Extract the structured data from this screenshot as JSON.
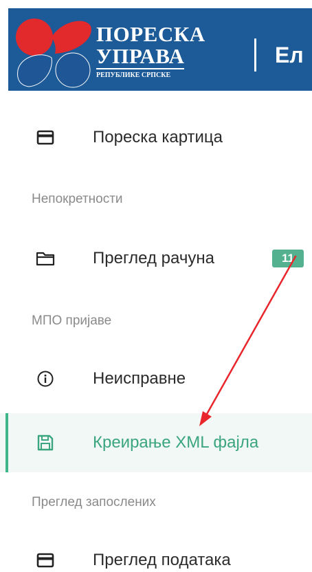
{
  "header": {
    "brand_line1": "ПОРЕСКА",
    "brand_line2": "УПРАВА",
    "brand_sub": "РЕПУБЛИКЕ СРПСКЕ",
    "title_fragment": "Ел",
    "bg_color": "#1c5a98",
    "logo_colors": {
      "top": "#e2292c",
      "bottom": "#1f5796"
    }
  },
  "menu": {
    "tax_card": {
      "label": "Пореска картица",
      "icon": "card-icon"
    },
    "real_estate_section": "Непокретности",
    "account_overview": {
      "label": "Преглед рачуна",
      "icon": "folder-icon",
      "badge": "11"
    },
    "mpo_section": "МПО пријаве",
    "invalid": {
      "label": "Неисправне",
      "icon": "info-icon"
    },
    "create_xml": {
      "label": "Креирање XML фајла",
      "icon": "save-icon",
      "active": true
    },
    "employees_section": "Преглед запослених",
    "data_overview": {
      "label": "Преглед података",
      "icon": "card-icon"
    }
  },
  "colors": {
    "active_accent": "#3fb58a",
    "active_bg": "#f2f8f6",
    "badge_bg": "#53b190",
    "annotation_arrow": "#e8262b"
  }
}
